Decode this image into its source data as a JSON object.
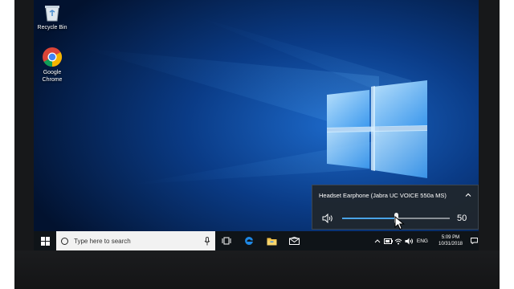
{
  "desktop": {
    "icons": [
      {
        "label": "Recycle Bin",
        "icon": "recycle-bin-icon"
      },
      {
        "label": "Google Chrome",
        "icon": "chrome-icon"
      }
    ]
  },
  "taskbar": {
    "search_placeholder": "Type here to search",
    "pinned": [
      "task-view-icon",
      "edge-icon",
      "file-explorer-icon",
      "mail-icon"
    ],
    "tray": {
      "language": "ENG",
      "time": "5:09 PM",
      "date": "10/31/2018"
    }
  },
  "volume_flyout": {
    "device_name": "Headset Earphone (Jabra UC VOICE 550a MS)",
    "volume": 50,
    "volume_label": "50"
  },
  "colors": {
    "accent": "#4aa3e6",
    "taskbar": "#0f1418",
    "wallpaper_dark": "#02122f",
    "wallpaper_light": "#2f8be6"
  }
}
